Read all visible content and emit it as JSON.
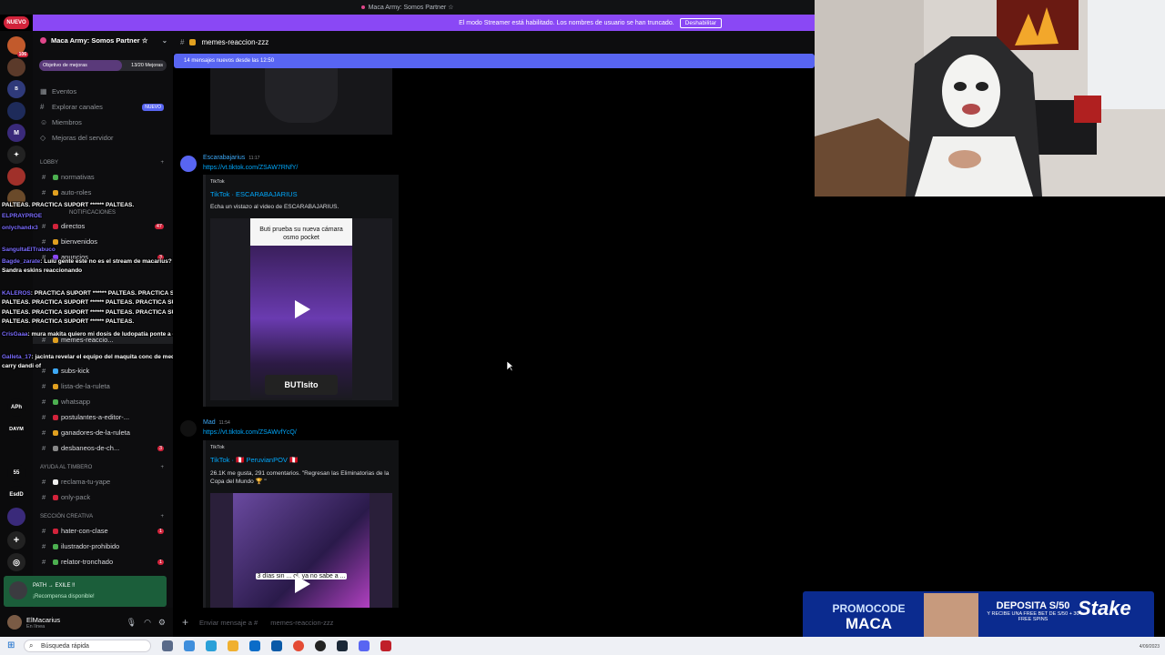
{
  "window_title": "Maca Army: Somos Partner ☆",
  "nuevo_badge": "NUEVO",
  "streamer_banner": {
    "text": "El modo Streamer está habilitado. Los nombres de usuario se han truncado.",
    "button": "Deshabilitar"
  },
  "server": {
    "name": "Maca Army: Somos Partner ☆",
    "boost_goal": "Objetivo de mejoras",
    "boost_progress": "13/20 Mejoras",
    "boost_fraction": 0.65
  },
  "rail": {
    "labels": [
      "106",
      "APh",
      "DAYM",
      "55",
      "EsdD"
    ]
  },
  "nav": [
    {
      "label": "Eventos",
      "icon": "calendar-icon"
    },
    {
      "label": "Explorar canales",
      "icon": "browse-icon",
      "tag": "NUEVO"
    },
    {
      "label": "Miembros",
      "icon": "members-icon"
    },
    {
      "label": "Mejoras del servidor",
      "icon": "boost-icon"
    }
  ],
  "categories": {
    "lobby": "LOBBY",
    "notificaciones": "NOTIFICACIONES",
    "ayuda": "AYUDA AL TIMBERO",
    "creativa": "SECCIÓN CREATIVA"
  },
  "channels": [
    {
      "name": "normativas",
      "count": ""
    },
    {
      "name": "auto-roles",
      "count": ""
    },
    {
      "name": "directos",
      "count": "47"
    },
    {
      "name": "bienvenidos",
      "count": ""
    },
    {
      "name": "anuncios",
      "count": "3"
    },
    {
      "name": "memes-reaccio...",
      "count": ""
    },
    {
      "name": "subs-kick",
      "count": ""
    },
    {
      "name": "lista-de-la-ruleta",
      "count": ""
    },
    {
      "name": "whatsapp",
      "count": ""
    },
    {
      "name": "postulantes-a-editor-...",
      "count": ""
    },
    {
      "name": "ganadores-de-la-ruleta",
      "count": ""
    },
    {
      "name": "desbaneos-de-ch...",
      "count": "3"
    },
    {
      "name": "reclama-tu-yape",
      "count": ""
    },
    {
      "name": "only-pack",
      "count": ""
    },
    {
      "name": "hater-con-clase",
      "count": "1"
    },
    {
      "name": "ilustrador-prohibido",
      "count": ""
    },
    {
      "name": "relator-tronchado",
      "count": "1"
    }
  ],
  "chat": [
    {
      "user": "",
      "text": "PALTEAS. PRACTICA SUPORT ****** PALTEAS."
    },
    {
      "user": "ELPRAYPROE",
      "text": ""
    },
    {
      "user": "onlychandx3",
      "text": ""
    },
    {
      "user": "SangultaElTrabuco",
      "text": ""
    },
    {
      "user": "Bagde_zarate",
      "text": ": Luiu gente este no es el stream de macarius? por qué está"
    },
    {
      "user": "",
      "text": "Sandra eskins reaccionando"
    },
    {
      "user": "KALEROS",
      "text": ": PRACTICA SUPORT ****** PALTEAS. PRACTICA SUPORT ******"
    },
    {
      "user": "",
      "text": "PALTEAS. PRACTICA SUPORT ****** PALTEAS. PRACTICA SUPORT ******"
    },
    {
      "user": "",
      "text": "PALTEAS. PRACTICA SUPORT ****** PALTEAS. PRACTICA SUPORT ******"
    },
    {
      "user": "",
      "text": "PALTEAS. PRACTICA SUPORT ****** PALTEAS."
    },
    {
      "user": "CrisGaaa",
      "text": ": mura makita quiero mi dosis de ludopatía ponte a dotear miera"
    },
    {
      "user": "Galleta_17",
      "text": ": jacinta revelar el equipo del maquita conc de medio dyracho de"
    },
    {
      "user": "",
      "text": "carry dandi of"
    }
  ],
  "activity": {
    "title": "PATH → EXILE !!",
    "subtitle": "¡Recompensa disponible!"
  },
  "user": {
    "name": "ElMacarius",
    "status": "En línea"
  },
  "channel_header": {
    "name": "memes-reaccion-zzz"
  },
  "new_messages": "14 mensajes nuevos desde las 12:50",
  "messages": [
    {
      "author": "Escarabajarius",
      "time": "11:17",
      "link": "https://vt.tiktok.com/ZSAW7RNfY/",
      "provider": "TikTok",
      "title": "TikTok · ESCARABAJARIUS",
      "desc": "Echa un vistazo al video de ESCARABAJARIUS.",
      "video_caption": "Buti prueba su nueva cámara osmo pocket",
      "video_tag": "BUTIsito"
    },
    {
      "author": "Mad",
      "time": "11:54",
      "link": "https://vt.tiktok.com/ZSAWvfYcQ/",
      "provider": "TikTok",
      "title": "TikTok · 🇵🇪 PeruvianPOV 🇵🇪",
      "desc": "26.1K me gusta, 291 comentarios. \"Regresan las Eliminatorias de la Copa del Mundo 🏆 \"",
      "video_caption": "3 días sin ... ol, ya no sabe a ..."
    }
  ],
  "composer_placeholder": "Enviar mensaje a #",
  "composer_channel": "memes-reaccion-zzz",
  "ad": {
    "promo_line1": "PROMOCODE",
    "promo_line2": "MACA",
    "deposit": "DEPOSITA S/50",
    "deposit_sub": "Y RECIBE UNA FREE BET DE S/50 + 30 FREE SPINS",
    "brand": "Stake"
  },
  "taskbar": {
    "search": "Búsqueda rápida",
    "clock": "4/09/2023"
  },
  "colors": {
    "accent": "#5865f2",
    "streamer": "#8a48f5",
    "link": "#00a8fc",
    "badge": "#d2233b"
  }
}
